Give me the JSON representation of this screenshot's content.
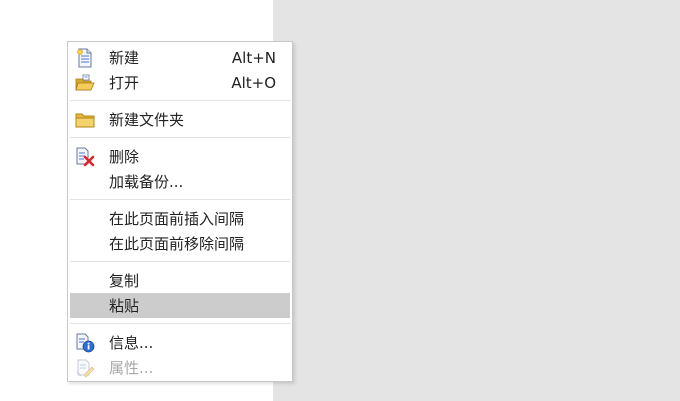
{
  "context_menu": {
    "items": [
      {
        "label": "新建",
        "shortcut": "Alt+N",
        "icon": "new-document-icon"
      },
      {
        "label": "打开",
        "shortcut": "Alt+O",
        "icon": "open-folder-icon"
      },
      {
        "label": "新建文件夹",
        "icon": "folder-icon"
      },
      {
        "label": "删除",
        "icon": "delete-icon"
      },
      {
        "label": "加载备份..."
      },
      {
        "label": "在此页面前插入间隔"
      },
      {
        "label": "在此页面前移除间隔"
      },
      {
        "label": "复制"
      },
      {
        "label": "粘贴",
        "state": "highlighted"
      },
      {
        "label": "信息...",
        "icon": "info-icon"
      },
      {
        "label": "属性...",
        "icon": "properties-icon",
        "state": "disabled"
      }
    ]
  },
  "colors": {
    "highlight": "#cccccc",
    "background_pane": "#e4e4e4",
    "disabled_text": "#a8a8a8",
    "folder_yellow": "#e8b93c",
    "delete_red": "#d9262a",
    "info_blue": "#2f6fcf"
  }
}
